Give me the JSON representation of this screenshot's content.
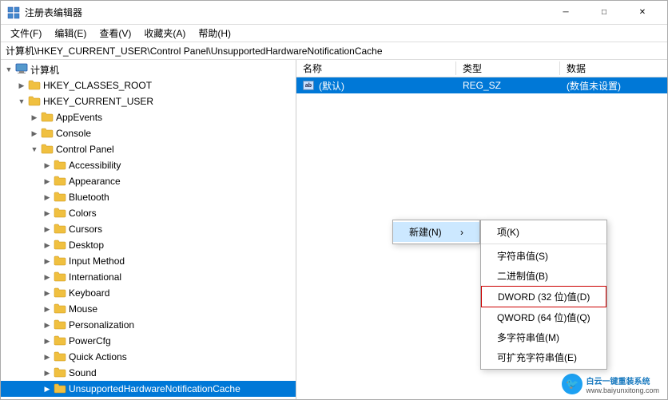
{
  "window": {
    "title": "注册表编辑器",
    "min_btn": "─",
    "max_btn": "□",
    "close_btn": "✕"
  },
  "menubar": {
    "items": [
      {
        "label": "文件(F)"
      },
      {
        "label": "编辑(E)"
      },
      {
        "label": "查看(V)"
      },
      {
        "label": "收藏夹(A)"
      },
      {
        "label": "帮助(H)"
      }
    ]
  },
  "address_bar": {
    "path": "计算机\\HKEY_CURRENT_USER\\Control Panel\\UnsupportedHardwareNotificationCache"
  },
  "tree": {
    "items": [
      {
        "id": "computer",
        "label": "计算机",
        "indent": 0,
        "toggle": "open",
        "type": "computer"
      },
      {
        "id": "hkcr",
        "label": "HKEY_CLASSES_ROOT",
        "indent": 1,
        "toggle": "closed",
        "type": "folder"
      },
      {
        "id": "hkcu",
        "label": "HKEY_CURRENT_USER",
        "indent": 1,
        "toggle": "open",
        "type": "folder"
      },
      {
        "id": "appevents",
        "label": "AppEvents",
        "indent": 2,
        "toggle": "closed",
        "type": "folder"
      },
      {
        "id": "console",
        "label": "Console",
        "indent": 2,
        "toggle": "closed",
        "type": "folder"
      },
      {
        "id": "control_panel",
        "label": "Control Panel",
        "indent": 2,
        "toggle": "open",
        "type": "folder"
      },
      {
        "id": "accessibility",
        "label": "Accessibility",
        "indent": 3,
        "toggle": "closed",
        "type": "folder"
      },
      {
        "id": "appearance",
        "label": "Appearance",
        "indent": 3,
        "toggle": "closed",
        "type": "folder"
      },
      {
        "id": "bluetooth",
        "label": "Bluetooth",
        "indent": 3,
        "toggle": "closed",
        "type": "folder"
      },
      {
        "id": "colors",
        "label": "Colors",
        "indent": 3,
        "toggle": "closed",
        "type": "folder"
      },
      {
        "id": "cursors",
        "label": "Cursors",
        "indent": 3,
        "toggle": "closed",
        "type": "folder"
      },
      {
        "id": "desktop",
        "label": "Desktop",
        "indent": 3,
        "toggle": "closed",
        "type": "folder"
      },
      {
        "id": "inputmethod",
        "label": "Input Method",
        "indent": 3,
        "toggle": "closed",
        "type": "folder"
      },
      {
        "id": "international",
        "label": "International",
        "indent": 3,
        "toggle": "closed",
        "type": "folder"
      },
      {
        "id": "keyboard",
        "label": "Keyboard",
        "indent": 3,
        "toggle": "closed",
        "type": "folder"
      },
      {
        "id": "mouse",
        "label": "Mouse",
        "indent": 3,
        "toggle": "closed",
        "type": "folder"
      },
      {
        "id": "personalization",
        "label": "Personalization",
        "indent": 3,
        "toggle": "closed",
        "type": "folder"
      },
      {
        "id": "powercfg",
        "label": "PowerCfg",
        "indent": 3,
        "toggle": "closed",
        "type": "folder"
      },
      {
        "id": "quickactions",
        "label": "Quick Actions",
        "indent": 3,
        "toggle": "closed",
        "type": "folder"
      },
      {
        "id": "sound",
        "label": "Sound",
        "indent": 3,
        "toggle": "closed",
        "type": "folder"
      },
      {
        "id": "unsupported",
        "label": "UnsupportedHardwareNotificationCache",
        "indent": 3,
        "toggle": "closed",
        "type": "folder",
        "selected": true
      }
    ]
  },
  "table": {
    "headers": {
      "name": "名称",
      "type": "类型",
      "data": "数据"
    },
    "rows": [
      {
        "name": "(默认)",
        "type": "REG_SZ",
        "data": "(数值未设置)",
        "icon": "ab"
      }
    ]
  },
  "context_menu": {
    "new_label": "新建(N)",
    "arrow": "›",
    "items": [
      {
        "label": "项(K)"
      },
      {
        "separator": true
      },
      {
        "label": "字符串值(S)"
      },
      {
        "label": "二进制值(B)"
      },
      {
        "label": "DWORD (32 位)值(D)",
        "highlighted": true
      },
      {
        "label": "QWORD (64 位)值(Q)"
      },
      {
        "label": "多字符串值(M)"
      },
      {
        "label": "可扩充字符串值(E)"
      }
    ]
  },
  "watermark": {
    "logo_char": "🐦",
    "site": "www.baiyunxitong.com",
    "text": "白云一键重装系统"
  }
}
